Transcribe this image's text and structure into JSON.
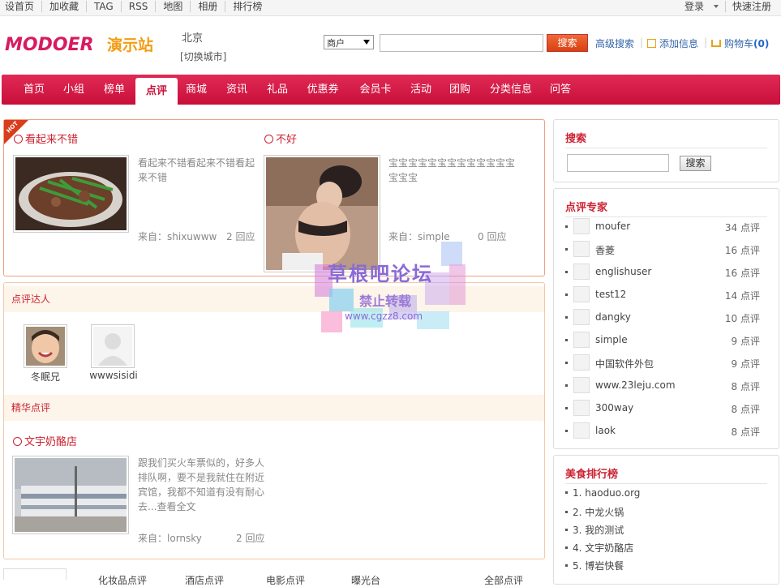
{
  "topbar": {
    "left_links": [
      "设首页",
      "加收藏",
      "TAG",
      "RSS",
      "地图",
      "相册",
      "排行榜"
    ],
    "login": "登录",
    "register": "快速注册"
  },
  "header": {
    "logo_text": "MODOER",
    "logo_sub": "演示站",
    "city": "北京",
    "switch_city": "[切换城市]",
    "search_type": "商户",
    "search_value": "",
    "search_button": "搜索",
    "advanced_search": "高级搜索",
    "add_info": "添加信息",
    "cart_label": "购物车",
    "cart_count": "(0)"
  },
  "nav": {
    "items": [
      "首页",
      "小组",
      "榜单",
      "点评",
      "商城",
      "资讯",
      "礼品",
      "优惠券",
      "会员卡",
      "活动",
      "团购",
      "分类信息",
      "问答"
    ],
    "active": "点评"
  },
  "hot": {
    "tag": "HOT",
    "reviews": [
      {
        "title": "看起来不错",
        "text": "看起来不错看起来不错看起来不错",
        "from_label": "来自：",
        "author": "shixuwww",
        "replies": "2 回应"
      },
      {
        "title": "不好",
        "text": "宝宝宝宝宝宝宝宝宝宝宝宝宝宝宝宝",
        "from_label": "来自：",
        "author": "simple",
        "replies": "0 回应"
      }
    ]
  },
  "talent": {
    "title": "点评达人",
    "users": [
      "冬眠兄",
      "wwwsisidi"
    ]
  },
  "featured": {
    "title": "精华点评",
    "review": {
      "title": "文宇奶酪店",
      "text": "跟我们买火车票似的，好多人排队啊，要不是我就住在附近宾馆，我都不知道有没有耐心去...",
      "more": "查看全文",
      "from_label": "来自：",
      "author": "lornsky",
      "replies": "2 回应"
    }
  },
  "bottom_tabs": [
    "化妆品点评",
    "酒店点评",
    "电影点评",
    "曝光台",
    "全部点评"
  ],
  "sidebar": {
    "search": {
      "title": "搜索",
      "button": "搜索",
      "value": ""
    },
    "experts": {
      "title": "点评专家",
      "rows": [
        {
          "name": "moufer",
          "count": "34 点评"
        },
        {
          "name": "香菱",
          "count": "16 点评"
        },
        {
          "name": "englishuser",
          "count": "16 点评"
        },
        {
          "name": "test12",
          "count": "14 点评"
        },
        {
          "name": "dangky",
          "count": "10 点评"
        },
        {
          "name": "simple",
          "count": "9 点评"
        },
        {
          "name": "中国软件外包",
          "count": "9 点评"
        },
        {
          "name": "www.23leju.com",
          "count": "8 点评"
        },
        {
          "name": "300way",
          "count": "8 点评"
        },
        {
          "name": "laok",
          "count": "8 点评"
        }
      ]
    },
    "food_rank": {
      "title": "美食排行榜",
      "items": [
        "1. haoduo.org",
        "2. 中龙火锅",
        "3. 我的测试",
        "4. 文宇奶酪店",
        "5. 博岩快餐"
      ]
    }
  },
  "watermark": {
    "line1": "草根吧论坛",
    "line2": "禁止转载",
    "line3": "www.cgzz8.com"
  },
  "colors": {
    "brand_red": "#c80f3a",
    "link_blue": "#3366aa",
    "title_red": "#cc2233"
  }
}
